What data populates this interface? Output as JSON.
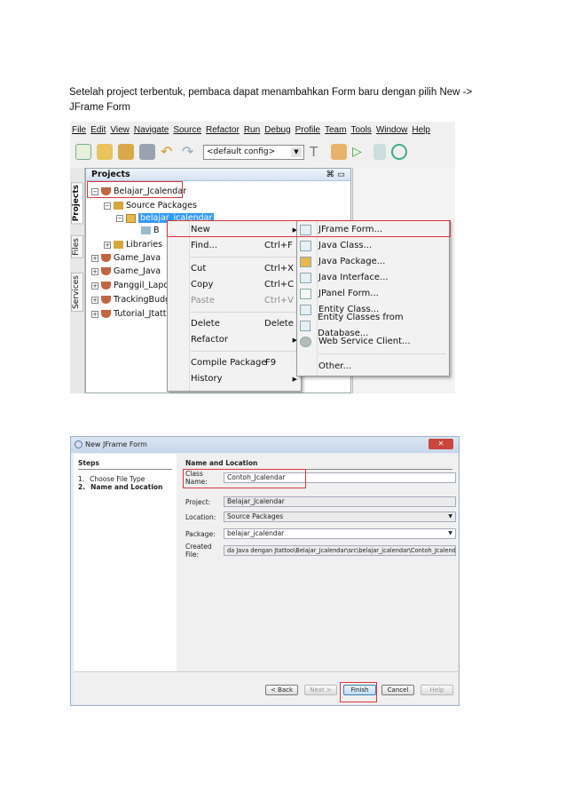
{
  "paragraph": "Setelah project terbentuk, pembaca dapat menambahkan Form baru dengan pilih New -> JFrame Form",
  "ide": {
    "menubar": [
      "File",
      "Edit",
      "View",
      "Navigate",
      "Source",
      "Refactor",
      "Run",
      "Debug",
      "Profile",
      "Team",
      "Tools",
      "Window",
      "Help"
    ],
    "config": "<default config>",
    "side_tabs": [
      "Projects",
      "Files",
      "Services"
    ],
    "panel_title": "Projects",
    "tree": {
      "root": "Belajar_Jcalendar",
      "source_packages": "Source Packages",
      "package": "belajar_jcalendar",
      "file": "B",
      "libraries": "Libraries",
      "others": [
        "Game_Java",
        "Game_Java",
        "Panggil_Lapor",
        "TrackingBudge",
        "Tutorial_Jtatt"
      ]
    },
    "context_menu": [
      {
        "label": "New",
        "shortcut": "",
        "submenu": true
      },
      {
        "label": "Find...",
        "shortcut": "Ctrl+F"
      },
      {
        "label": "Cut",
        "shortcut": "Ctrl+X"
      },
      {
        "label": "Copy",
        "shortcut": "Ctrl+C"
      },
      {
        "label": "Paste",
        "shortcut": "Ctrl+V",
        "disabled": true
      },
      {
        "label": "Delete",
        "shortcut": "Delete"
      },
      {
        "label": "Refactor",
        "shortcut": "",
        "submenu": true
      },
      {
        "label": "Compile Package",
        "shortcut": "F9"
      },
      {
        "label": "History",
        "shortcut": "",
        "submenu": true
      }
    ],
    "submenu": [
      "JFrame Form...",
      "Java Class...",
      "Java Package...",
      "Java Interface...",
      "JPanel Form...",
      "Entity Class...",
      "Entity Classes from Database...",
      "Web Service Client...",
      "Other..."
    ]
  },
  "dialog": {
    "title": "New JFrame Form",
    "steps_title": "Steps",
    "steps": [
      "1.",
      "Choose File Type",
      "2.",
      "Name and Location"
    ],
    "section": "Name and Location",
    "class_name_label": "Class Name:",
    "class_name": "Contoh_Jcalendar",
    "project_label": "Project:",
    "project": "Belajar_Jcalendar",
    "location_label": "Location:",
    "location": "Source Packages",
    "package_label": "Package:",
    "package": "belajar_jcalendar",
    "created_label": "Created File:",
    "created": "da Java dengan Jtattoo\\Belajar_Jcalendar\\src\\belajar_jcalendar\\Contoh_Jcalendar.java",
    "buttons": [
      "< Back",
      "Next >",
      "Finish",
      "Cancel",
      "Help"
    ]
  },
  "colors": {
    "highlight_box": "#d9363e",
    "selection": "#3399ff"
  }
}
